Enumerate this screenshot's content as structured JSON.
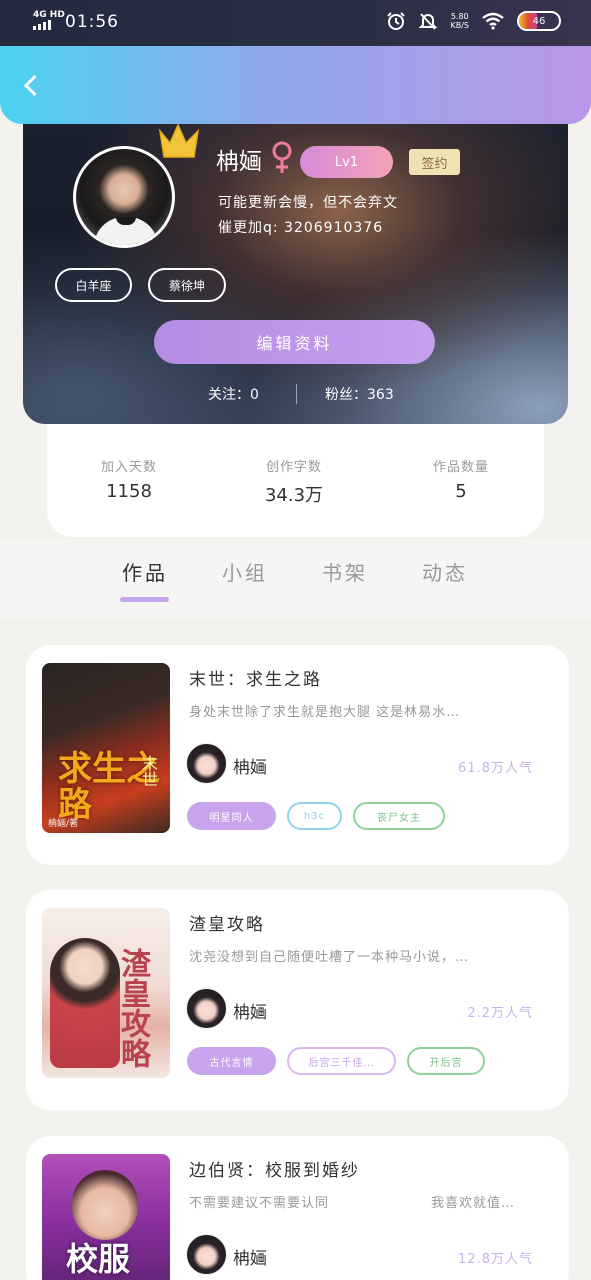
{
  "status_bar": {
    "network": "4G HD",
    "time": "01:56",
    "speed_value": "5.80",
    "speed_unit": "KB/S",
    "battery": "46",
    "battery_level": 0.46,
    "icons": [
      "alarm-icon",
      "mute-icon",
      "wifi-icon",
      "battery-icon"
    ]
  },
  "header": {
    "back_icon": "back-arrow-icon",
    "gradient_colors": [
      "#4bd2f0",
      "#b996e8"
    ]
  },
  "profile": {
    "name": "柟婳",
    "gender_symbol": "♀",
    "level": "Lv1",
    "signed": "签约",
    "bio_line1": "可能更新会慢，但不会弃文",
    "bio_line2": "催更加q: 3206910376",
    "tags": [
      "白羊座",
      "蔡徐坤"
    ],
    "edit_button": "编辑资料",
    "following": "关注：0",
    "fans": "粉丝：363"
  },
  "stats": [
    {
      "label": "加入天数",
      "value": "1158"
    },
    {
      "label": "创作字数",
      "value": "34.3万"
    },
    {
      "label": "作品数量",
      "value": "5"
    }
  ],
  "tabs": [
    "作品",
    "小组",
    "书架",
    "动态"
  ],
  "books": [
    {
      "title": "末世：求生之路",
      "desc": "身处末世除了求生就是抱大腿 这是林易水…",
      "author": "柟婳",
      "popularity": "61.8万人气",
      "cover_text": "求生之路",
      "cover_sub": "末世",
      "cover_author": "柟婳/著",
      "tags": [
        "明星同人",
        "h3c",
        "丧尸女主"
      ]
    },
    {
      "title": "渣皇攻略",
      "desc": "沈尧没想到自己随便吐槽了一本种马小说，…",
      "author": "柟婳",
      "popularity": "2.2万人气",
      "cover_text": "渣皇攻略",
      "tags": [
        "古代言情",
        "后宫三千佳…",
        "开后宫"
      ]
    },
    {
      "title": "边伯贤：校服到婚纱",
      "desc": "不需要建议不需要认同",
      "desc2": "我喜欢就值…",
      "author": "柟婳",
      "popularity": "12.8万人气",
      "cover_text": "校服"
    }
  ],
  "colors": {
    "accent": "#c4a6ec",
    "lv_badge": "#e39ad0",
    "sign_badge": "#efe2b4",
    "popularity": "#c9b3e8"
  }
}
